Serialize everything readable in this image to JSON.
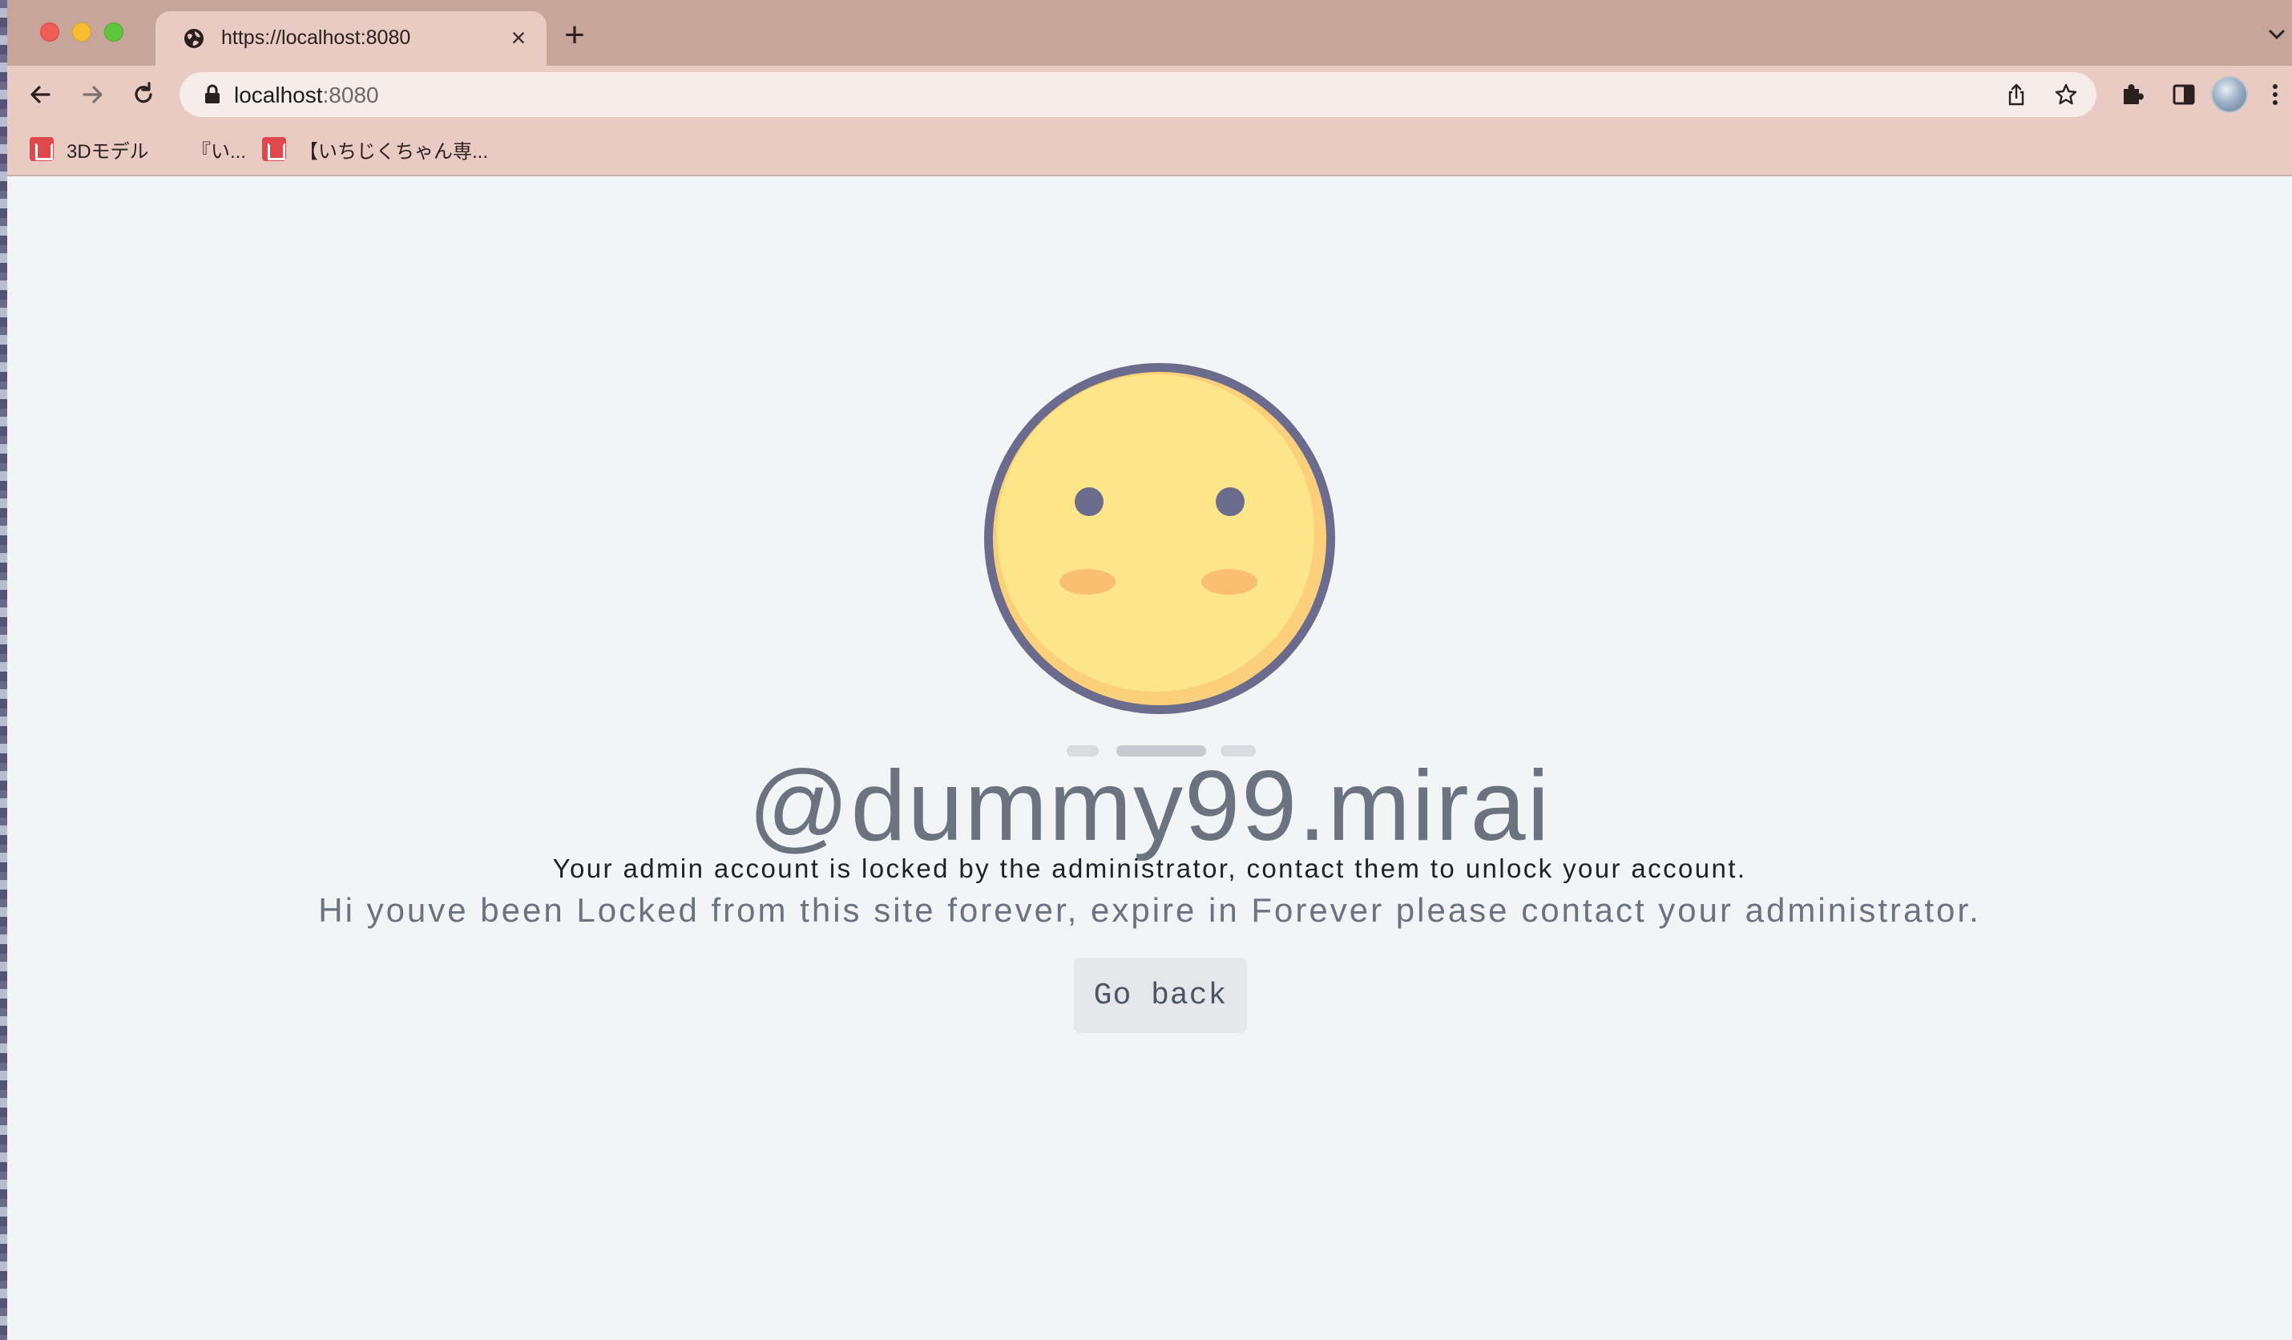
{
  "browser": {
    "tab": {
      "title": "https://localhost:8080"
    },
    "address_bar": {
      "host": "localhost",
      "port": ":8080"
    },
    "bookmarks": [
      {
        "label": "3Dモデル"
      },
      {
        "label": "『い..."
      },
      {
        "label": "【いちじくちゃん専..."
      }
    ]
  },
  "page": {
    "username": "@dummy99.mirai",
    "message_primary": "Your admin account is locked by the administrator, contact them to unlock your account.",
    "message_secondary": "Hi youve been Locked from this site forever, expire in Forever please contact your administrator.",
    "go_back_label": "Go back"
  },
  "colors": {
    "tab_strip": "#c7a59b",
    "toolbar": "#eacbc4",
    "page_background": "#f3f4f6",
    "face_fill": "#fde68a",
    "face_outline": "#6b6b8e",
    "cheeks": "#fbbf72",
    "text_muted": "#6b7280",
    "button_background": "#e5e7eb"
  },
  "icons": {
    "tab": "globe-icon",
    "toolbar": [
      "back-arrow-icon",
      "forward-arrow-icon",
      "reload-icon",
      "lock-icon",
      "share-icon",
      "star-icon",
      "extensions-puzzle-icon",
      "side-panel-icon",
      "profile-avatar",
      "kebab-menu-icon"
    ],
    "page": "neutral-face-emoji"
  }
}
